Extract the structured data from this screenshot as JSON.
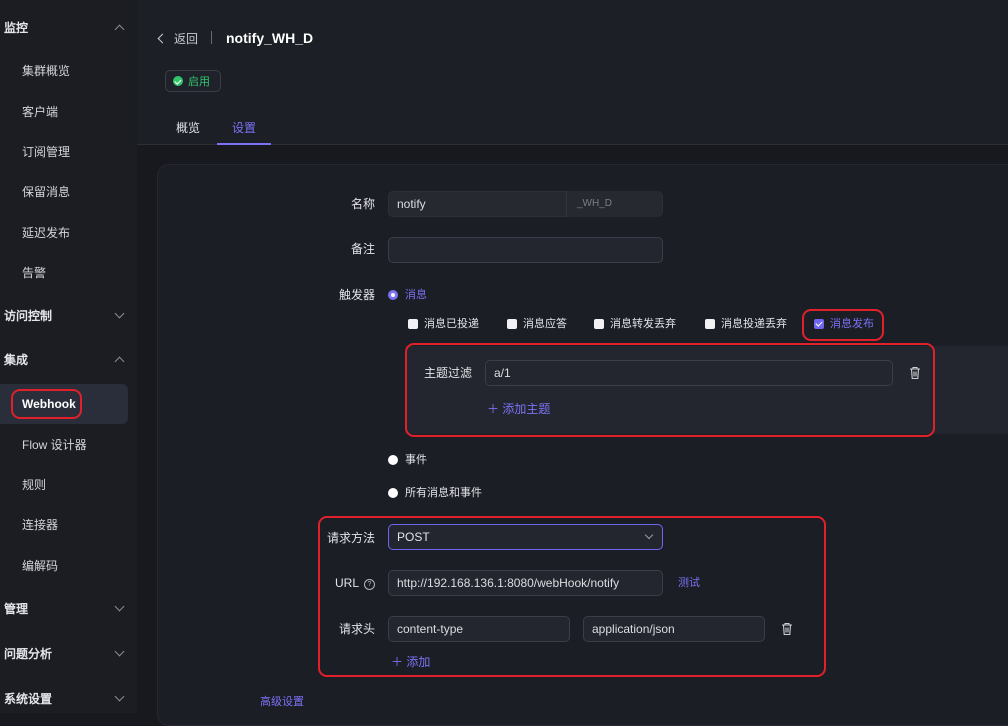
{
  "sidebar": {
    "groups": [
      {
        "label": "监控",
        "state": "expanded"
      },
      {
        "label": "访问控制",
        "state": "collapsed"
      },
      {
        "label": "集成",
        "state": "expanded"
      },
      {
        "label": "管理",
        "state": "collapsed"
      },
      {
        "label": "问题分析",
        "state": "collapsed"
      },
      {
        "label": "系统设置",
        "state": "collapsed"
      }
    ],
    "monitor_items": [
      "集群概览",
      "客户端",
      "订阅管理",
      "保留消息",
      "延迟发布",
      "告警"
    ],
    "integration_items": [
      "Webhook",
      "Flow 设计器",
      "规则",
      "连接器",
      "编解码"
    ],
    "active_item": "Webhook"
  },
  "header": {
    "back_label": "返回",
    "title": "notify_WH_D",
    "status": "启用",
    "status_color": "#32c46b",
    "tabs": [
      "概览",
      "设置"
    ],
    "active_tab": "设置"
  },
  "form": {
    "name_label": "名称",
    "name_value": "notify",
    "name_suffix": "_WH_D",
    "note_label": "备注",
    "note_value": "",
    "trigger_label": "触发器",
    "trigger_options": {
      "message": "消息",
      "event": "事件",
      "all": "所有消息和事件"
    },
    "trigger_selected": "消息",
    "message_checks": [
      {
        "label": "消息已投递",
        "checked": false
      },
      {
        "label": "消息应答",
        "checked": false
      },
      {
        "label": "消息转发丢弃",
        "checked": false
      },
      {
        "label": "消息投递丢弃",
        "checked": false
      },
      {
        "label": "消息发布",
        "checked": true
      }
    ],
    "topic_filter_label": "主题过滤",
    "topic_filter_value": "a/1",
    "add_topic_label": "添加主题",
    "method_label": "请求方法",
    "method_value": "POST",
    "url_label": "URL",
    "url_value": "http://192.168.136.1:8080/webHook/notify",
    "test_label": "测试",
    "headers_label": "请求头",
    "header_key": "content-type",
    "header_value": "application/json",
    "add_header_label": "添加",
    "advanced_label": "高级设置"
  },
  "colors": {
    "accent": "#7b72f5",
    "highlight_border": "#e0202a",
    "background": "#17191f"
  }
}
